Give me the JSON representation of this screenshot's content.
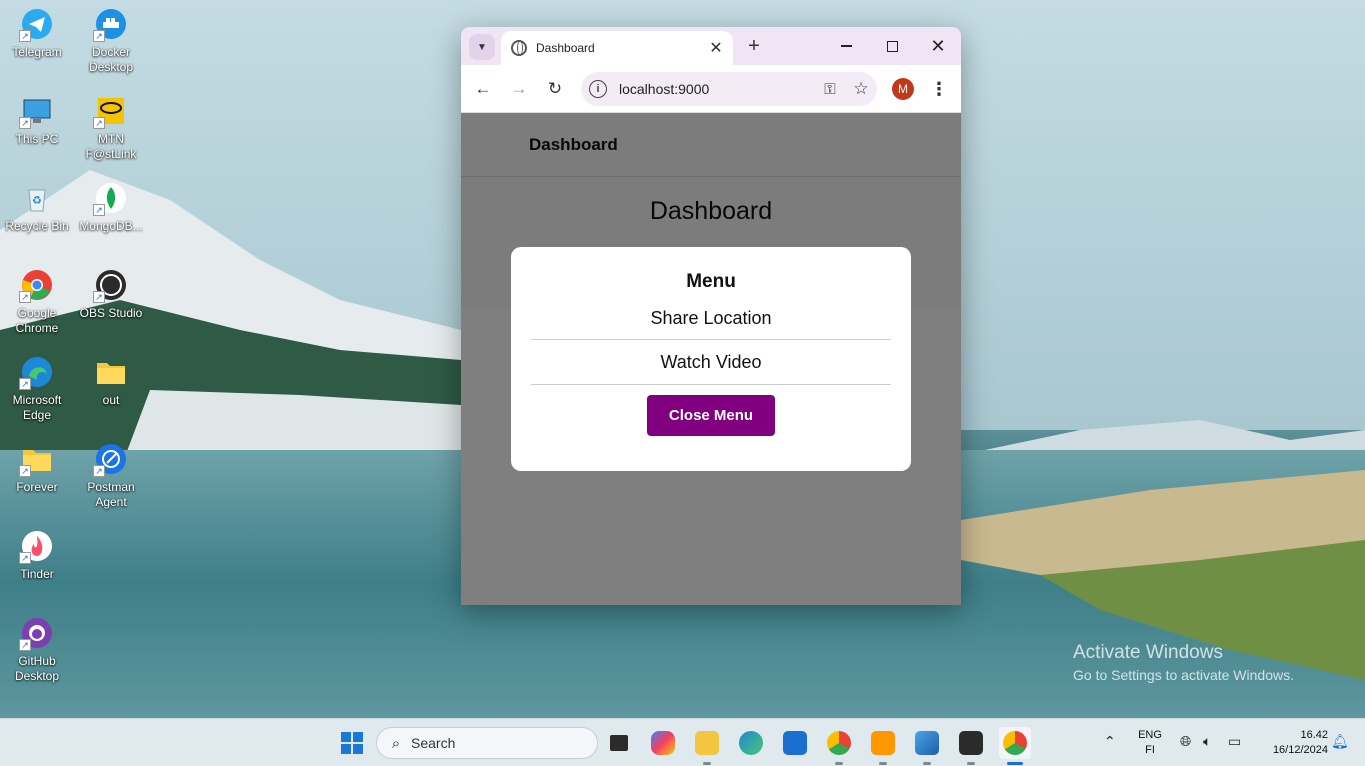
{
  "desktop": {
    "icons": [
      {
        "label": "Telegram",
        "icon": "telegram-icon",
        "color": "#2AABEE"
      },
      {
        "label": "Docker Desktop",
        "icon": "docker-icon",
        "color": "#1D91E6"
      },
      {
        "label": "This PC",
        "icon": "computer-icon",
        "color": "#3aa0e0"
      },
      {
        "label": "MTN F@stLink",
        "icon": "mtn-icon",
        "color": "#f5c400"
      },
      {
        "label": "Recycle Bin",
        "icon": "recycle-bin-icon",
        "color": "#e8f1f6"
      },
      {
        "label": "MongoDB...",
        "icon": "mongodb-icon",
        "color": "#ffffff"
      },
      {
        "label": "Google Chrome",
        "icon": "chrome-icon",
        "color": "#e94235"
      },
      {
        "label": "OBS Studio",
        "icon": "obs-icon",
        "color": "#2b2b2b"
      },
      {
        "label": "Microsoft Edge",
        "icon": "edge-icon",
        "color": "#1e88d8"
      },
      {
        "label": "out",
        "icon": "folder-icon",
        "color": "#f3c63f"
      },
      {
        "label": "Forever",
        "icon": "folder-icon",
        "color": "#f3c63f"
      },
      {
        "label": "Postman Agent",
        "icon": "postman-icon",
        "color": "#1a73e8"
      },
      {
        "label": "Tinder",
        "icon": "tinder-icon",
        "color": "#fd5068"
      },
      {
        "label": "GitHub Desktop",
        "icon": "github-icon",
        "color": "#7b3fb0"
      }
    ]
  },
  "browser": {
    "tab_title": "Dashboard",
    "url": "localhost:9000",
    "profile_initial": "M",
    "close_glyph": "✕",
    "newtab_glyph": "+"
  },
  "app": {
    "header_title": "Dashboard",
    "page_heading": "Dashboard",
    "modal": {
      "title": "Menu",
      "items": [
        "Share Location",
        "Watch Video"
      ],
      "close_label": "Close Menu",
      "accent": "#800080"
    }
  },
  "watermark": {
    "line1": "Activate Windows",
    "line2": "Go to Settings to activate Windows."
  },
  "taskbar": {
    "search_placeholder": "Search",
    "lang": "ENG",
    "region": "FI",
    "time": "16.42",
    "date": "16/12/2024"
  }
}
